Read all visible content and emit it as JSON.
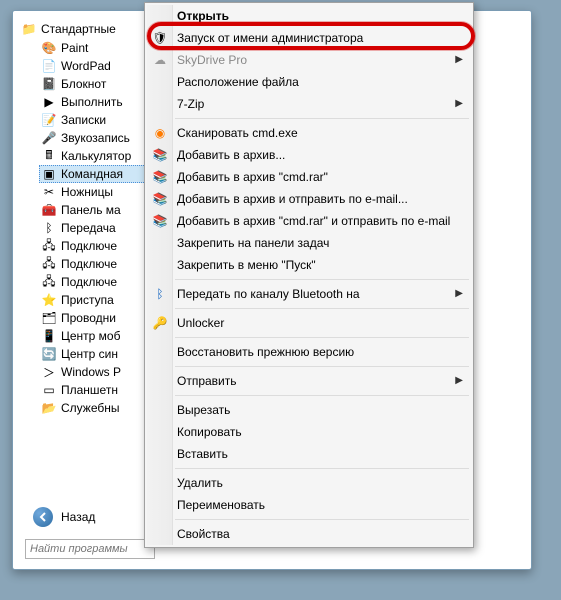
{
  "tree": {
    "root": "Стандартные",
    "items": [
      "Paint",
      "WordPad",
      "Блокнот",
      "Выполнить",
      "Записки",
      "Звукозапись",
      "Калькулятор",
      "Командная",
      "Ножницы",
      "Панель ма",
      "Передача",
      "Подключе",
      "Подключе",
      "Подключе",
      "Приступа",
      "Проводни",
      "Центр моб",
      "Центр син",
      "Windows P",
      "Планшетн",
      "Служебны"
    ],
    "selected_index": 7
  },
  "back_label": "Назад",
  "search_placeholder": "Найти программы",
  "ctx": [
    {
      "t": "item",
      "label": "Открыть",
      "bold": true
    },
    {
      "t": "item",
      "label": "Запуск от имени администратора",
      "icon": "shield"
    },
    {
      "t": "item",
      "label": "SkyDrive Pro",
      "icon": "cloud",
      "dim": true,
      "sub": true
    },
    {
      "t": "item",
      "label": "Расположение файла"
    },
    {
      "t": "item",
      "label": "7-Zip",
      "sub": true
    },
    {
      "t": "sep"
    },
    {
      "t": "item",
      "label": "Сканировать cmd.exe",
      "icon": "avast"
    },
    {
      "t": "item",
      "label": "Добавить в архив...",
      "icon": "rar"
    },
    {
      "t": "item",
      "label": "Добавить в архив \"cmd.rar\"",
      "icon": "rar"
    },
    {
      "t": "item",
      "label": "Добавить в архив и отправить по e-mail...",
      "icon": "rar"
    },
    {
      "t": "item",
      "label": "Добавить в архив \"cmd.rar\" и отправить по e-mail",
      "icon": "rar"
    },
    {
      "t": "item",
      "label": "Закрепить на панели задач"
    },
    {
      "t": "item",
      "label": "Закрепить в меню \"Пуск\""
    },
    {
      "t": "sep"
    },
    {
      "t": "item",
      "label": "Передать по каналу Bluetooth на",
      "icon": "bt",
      "sub": true
    },
    {
      "t": "sep"
    },
    {
      "t": "item",
      "label": "Unlocker",
      "icon": "key"
    },
    {
      "t": "sep"
    },
    {
      "t": "item",
      "label": "Восстановить прежнюю версию"
    },
    {
      "t": "sep"
    },
    {
      "t": "item",
      "label": "Отправить",
      "sub": true
    },
    {
      "t": "sep"
    },
    {
      "t": "item",
      "label": "Вырезать"
    },
    {
      "t": "item",
      "label": "Копировать"
    },
    {
      "t": "item",
      "label": "Вставить"
    },
    {
      "t": "sep"
    },
    {
      "t": "item",
      "label": "Удалить"
    },
    {
      "t": "item",
      "label": "Переименовать"
    },
    {
      "t": "sep"
    },
    {
      "t": "item",
      "label": "Свойства"
    }
  ],
  "icons": {
    "folder": "📁",
    "paint": "🎨",
    "wordpad": "📄",
    "notepad": "📓",
    "run": "▶",
    "notes": "📝",
    "sound": "🎤",
    "calc": "🖩",
    "cmd": "▣",
    "snip": "✂",
    "panel": "🧰",
    "bt": "ᛒ",
    "net": "🖧",
    "disk": "💽",
    "start": "⭐",
    "explorer": "🗂",
    "mob": "📱",
    "sync": "🔄",
    "ps": "＞",
    "tablet": "▭",
    "service": "📂",
    "shield": "🛡",
    "cloud": "☁",
    "avast": "◉",
    "rar": "📚",
    "key": "🔑",
    "arrow": "◀"
  }
}
